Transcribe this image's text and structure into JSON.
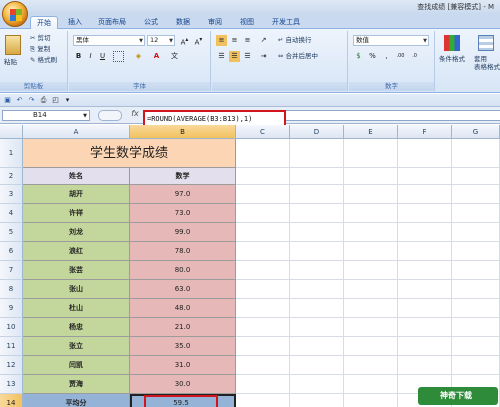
{
  "window": {
    "title": "查找成绩 [兼容模式] - M"
  },
  "tabs": [
    {
      "label": "开始"
    },
    {
      "label": "插入"
    },
    {
      "label": "页面布局"
    },
    {
      "label": "公式"
    },
    {
      "label": "数据"
    },
    {
      "label": "审阅"
    },
    {
      "label": "视图"
    },
    {
      "label": "开发工具"
    }
  ],
  "ribbon": {
    "clipboard": {
      "paste": "粘贴",
      "cut": "剪切",
      "copy": "复制",
      "format_painter": "格式刷",
      "label": "剪贴板"
    },
    "font": {
      "family": "黑体",
      "size": "12",
      "label": "字体",
      "bold": "B",
      "italic": "I",
      "underline": "U"
    },
    "alignment": {
      "wrap": "自动换行",
      "merge": "合并后居中"
    },
    "number": {
      "format": "数值",
      "label": "数字"
    },
    "styles": {
      "conditional": "条件格式",
      "table": "套用\n表格格式"
    }
  },
  "formula_bar": {
    "name_box": "B14",
    "fx": "fx",
    "formula": "=ROUND(AVERAGE(B3:B13),1)"
  },
  "columns": [
    "A",
    "B",
    "C",
    "D",
    "E",
    "F",
    "G"
  ],
  "rows": [
    "1",
    "2",
    "3",
    "4",
    "5",
    "6",
    "7",
    "8",
    "9",
    "10",
    "11",
    "12",
    "13",
    "14"
  ],
  "sheet": {
    "title": "学生数学成绩",
    "headers": {
      "name": "姓名",
      "score": "数学"
    },
    "students": [
      {
        "name": "胡开",
        "score": "97.0"
      },
      {
        "name": "许祥",
        "score": "73.0"
      },
      {
        "name": "刘龙",
        "score": "99.0"
      },
      {
        "name": "浪红",
        "score": "78.0"
      },
      {
        "name": "张芸",
        "score": "80.0"
      },
      {
        "name": "张山",
        "score": "63.0"
      },
      {
        "name": "杜山",
        "score": "48.0"
      },
      {
        "name": "杨忠",
        "score": "21.0"
      },
      {
        "name": "张立",
        "score": "35.0"
      },
      {
        "name": "闫凯",
        "score": "31.0"
      },
      {
        "name": "贾海",
        "score": "30.0"
      }
    ],
    "average": {
      "label": "平均分",
      "value": "59.5"
    }
  },
  "watermark": "神奇下载",
  "colors": {
    "title_fill": "#fcd5b4",
    "name_fill": "#c3d69b",
    "score_fill": "#e6b8b7",
    "header_fill": "#e4dfec",
    "avg_fill": "#95b3d7",
    "highlight": "#d2141c"
  }
}
